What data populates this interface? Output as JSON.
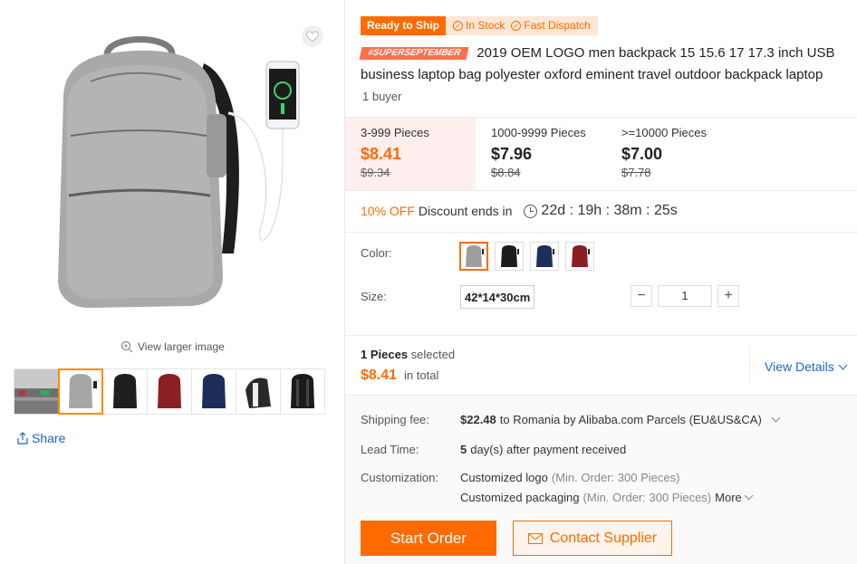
{
  "gallery": {
    "view_larger_label": "View larger image",
    "share_label": "Share",
    "thumbnails": [
      {
        "name": "video-thumbnail",
        "color": "#8a8a8a"
      },
      {
        "name": "gray-backpack-thumbnail",
        "color": "#a0a0a0"
      },
      {
        "name": "black-backpack-thumbnail",
        "color": "#222222"
      },
      {
        "name": "red-backpack-thumbnail",
        "color": "#8a1f24"
      },
      {
        "name": "blue-backpack-thumbnail",
        "color": "#1e2c58"
      },
      {
        "name": "side-backpack-thumbnail",
        "color": "#2a2a2a"
      },
      {
        "name": "back-backpack-thumbnail",
        "color": "#1a1a1a"
      }
    ]
  },
  "badges": {
    "ready_to_ship": "Ready to Ship",
    "in_stock": "In Stock",
    "fast_dispatch": "Fast Dispatch"
  },
  "product": {
    "tag": "#SUPERSEPTEMBER",
    "title": "2019 OEM LOGO men backpack 15 15.6 17 17.3 inch USB business laptop bag polyester oxford eminent travel outdoor backpack laptop",
    "buyers": "1 buyer"
  },
  "price_tiers": [
    {
      "qty": "3-999 Pieces",
      "price": "$8.41",
      "old": "$9.34"
    },
    {
      "qty": "1000-9999 Pieces",
      "price": "$7.96",
      "old": "$8.84"
    },
    {
      "qty": ">=10000 Pieces",
      "price": "$7.00",
      "old": "$7.78"
    }
  ],
  "discount": {
    "off": "10% OFF",
    "text": "Discount ends in",
    "timer": "22d : 19h : 38m : 25s"
  },
  "options": {
    "color_label": "Color:",
    "colors": [
      "#9e9e9e",
      "#1c1c1c",
      "#1f2d5c",
      "#8b1e25"
    ],
    "size_label": "Size:",
    "size_value": "42*14*30cm",
    "qty_minus": "−",
    "qty_plus": "+",
    "qty_value": "1"
  },
  "selection": {
    "count": "1 Pieces",
    "selected_text": "selected",
    "total": "$8.41",
    "total_suffix": "in total",
    "view_details": "View Details"
  },
  "info": {
    "shipping_label": "Shipping fee:",
    "shipping_amount": "$22.48",
    "shipping_text": "to Romania by Alibaba.com Parcels (EU&US&CA)",
    "lead_label": "Lead Time:",
    "lead_days": "5",
    "lead_text": "day(s) after payment received",
    "custom_label": "Customization:",
    "custom_logo": "Customized logo",
    "custom_logo_min": "(Min. Order: 300 Pieces)",
    "custom_pack": "Customized packaging",
    "custom_pack_min": "(Min. Order: 300 Pieces)",
    "more": "More"
  },
  "actions": {
    "start_order": "Start Order",
    "contact_supplier": "Contact Supplier"
  },
  "colors": {
    "accent": "#ff6a00",
    "link": "#1a66c4"
  }
}
